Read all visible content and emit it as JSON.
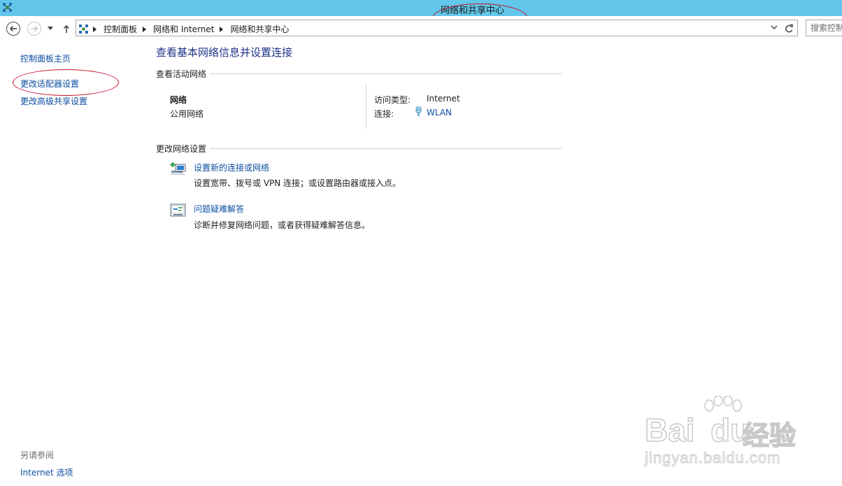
{
  "window": {
    "title": "网络和共享中心",
    "app_icon": "network-center-icon"
  },
  "nav": {
    "back_icon": "back-arrow-icon",
    "forward_icon": "forward-arrow-icon",
    "history_icon": "chevron-down-icon",
    "up_icon": "up-arrow-icon",
    "breadcrumbs": [
      "控制面板",
      "网络和 Internet",
      "网络和共享中心"
    ],
    "search_placeholder": "搜索控制面板"
  },
  "sidebar": {
    "items": [
      {
        "label": "控制面板主页"
      },
      {
        "label": "更改适配器设置"
      },
      {
        "label": "更改高级共享设置"
      }
    ],
    "see_also_heading": "另请参阅",
    "see_also_items": [
      {
        "label": "Internet 选项"
      }
    ]
  },
  "main": {
    "title": "查看基本网络信息并设置连接",
    "active_networks_heading": "查看活动网络",
    "network": {
      "name": "网络",
      "type": "公用网络",
      "access_type_label": "访问类型:",
      "access_type_value": "Internet",
      "connection_label": "连接:",
      "connection_value": "WLAN",
      "connection_icon": "wifi-signal-icon"
    },
    "change_settings_heading": "更改网络设置",
    "tasks": [
      {
        "link": "设置新的连接或网络",
        "desc": "设置宽带、拨号或 VPN 连接；或设置路由器或接入点。",
        "icon": "new-connection-icon"
      },
      {
        "link": "问题疑难解答",
        "desc": "诊断并修复网络问题，或者获得疑难解答信息。",
        "icon": "troubleshoot-icon"
      }
    ]
  },
  "watermark": {
    "brand_latin": "Bai",
    "brand_latin_2": "du",
    "brand_cn": "经验",
    "url": "jingyan.baidu.com"
  },
  "colors": {
    "titlebar": "#62c7ea",
    "link": "#0b4ea2",
    "heading": "#1e3287",
    "annotation": "#c8102e"
  }
}
